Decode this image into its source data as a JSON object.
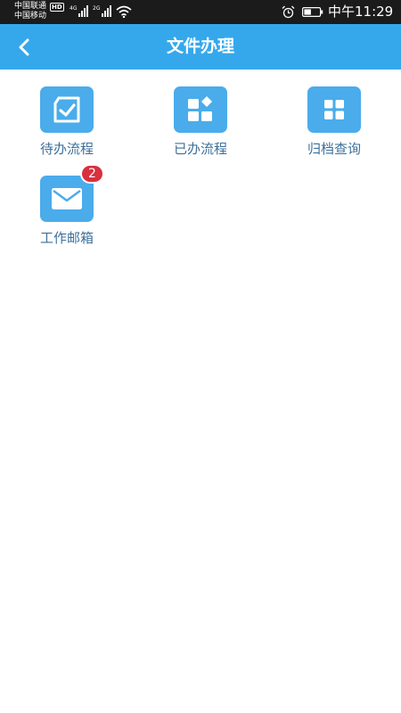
{
  "status_bar": {
    "carrier_1": "中国联通",
    "hd_badge": "HD",
    "carrier_2": "中国移动",
    "network_1": "4G",
    "network_2": "2G",
    "time": "中午11:29"
  },
  "header": {
    "title": "文件办理",
    "back_icon": "chevron-left-icon"
  },
  "tiles": [
    {
      "label": "待办流程",
      "icon": "checkbox-document-icon"
    },
    {
      "label": "已办流程",
      "icon": "grid-diamond-icon"
    },
    {
      "label": "归档查询",
      "icon": "four-squares-icon"
    },
    {
      "label": "工作邮箱",
      "icon": "envelope-icon",
      "badge": "2"
    }
  ],
  "colors": {
    "header_bg": "#35a8ec",
    "icon_bg": "#4aaceb",
    "label_text": "#3c6f9a",
    "badge_bg": "#d8303e",
    "status_bar_bg": "#1b1b1b"
  }
}
